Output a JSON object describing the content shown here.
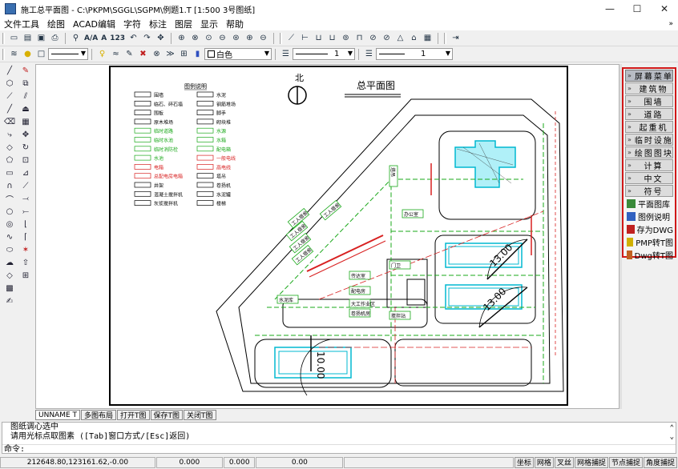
{
  "window": {
    "title": "施工总平面图 - C:\\PKPM\\SGGL\\SGPM\\例题1.T  [1:500  3号图纸]",
    "controls": {
      "minimize": "—",
      "maximize": "☐",
      "close": "✕"
    }
  },
  "menu": [
    "文件工具",
    "绘图",
    "ACAD编辑",
    "字符",
    "标注",
    "图层",
    "显示",
    "帮助"
  ],
  "toolbar2": {
    "layer_name": "白色",
    "linetype_value": "1",
    "lineweight_value": "1"
  },
  "drawing": {
    "north_label": "北",
    "plan_title": "总平面图",
    "legend_title": "图例说明",
    "legend_left": [
      "围墙",
      "临石、碎石墙",
      "围板",
      "原木堆场",
      "临时道路",
      "临时水池",
      "临时消防栓",
      "水池",
      "电箱",
      "总配电房电箱",
      "井架",
      "混凝土搅拌机",
      "灰浆搅拌机"
    ],
    "legend_right": [
      "水泥",
      "钢筋堆场",
      "脚手",
      "砌块堆",
      "水源",
      "水箱",
      "配电箱",
      "一般电线",
      "高电线",
      "塔吊",
      "卷扬机",
      "水泥罐",
      "楼梯"
    ],
    "site_labels": [
      "工人宿舍",
      "工人宿舍",
      "工人宿舍",
      "工人宿舍",
      "工人宿舍",
      "办公室",
      "塔吊",
      "门卫",
      "传达室",
      "配电房",
      "搅拌站",
      "大工作业区",
      "卷扬机房",
      "水泥库"
    ],
    "dimension_labels": [
      "13.00",
      "13.00",
      "10.00"
    ]
  },
  "screen_menu": {
    "header": "屏幕菜单",
    "buttons": [
      "建筑物",
      "围墙",
      "道路",
      "起重机",
      "临时设施",
      "绘图图块",
      "计算",
      "中文",
      "符号"
    ],
    "items": [
      "平面图库",
      "图例说明",
      "存为DWG",
      "PMP转T图",
      "Dwg转T图"
    ]
  },
  "tabs": [
    "UNNAME T",
    "多图布局",
    "打开T图",
    "保存T图",
    "关闭T图"
  ],
  "command": {
    "history": [
      "图纸调心选中",
      "请用光标点取图素 ([Tab]窗口方式/[Esc]返回)"
    ],
    "prompt_label": "命令:"
  },
  "status": {
    "coords": "212648.80,123161.62,-0.00",
    "v1": "0.000",
    "v2": "0.000",
    "v3": "0.00",
    "buttons": [
      "坐标",
      "网格",
      "叉丝",
      "网格捕捉",
      "节点捕捉",
      "角度捕捉"
    ]
  },
  "colors": {
    "screen_menu_border": "#d01818",
    "site_green": "#1aa81a",
    "site_red": "#d82020",
    "building_cyan": "#00b8d0"
  }
}
